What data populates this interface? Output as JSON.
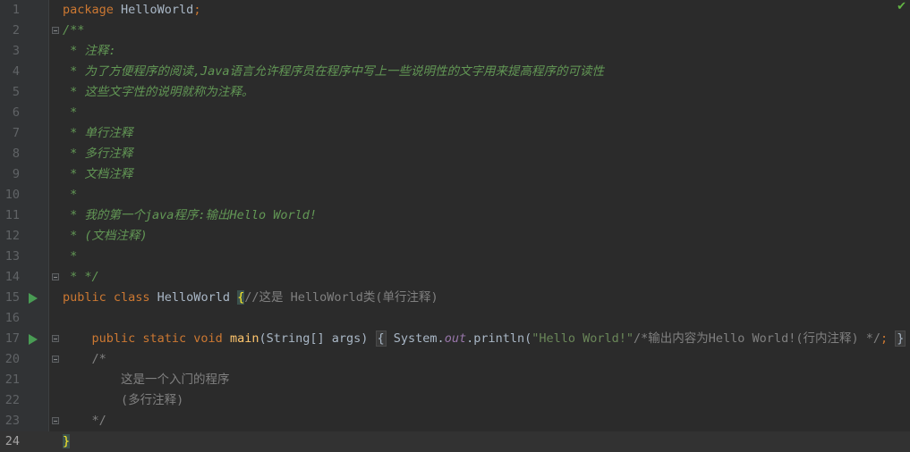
{
  "status": {
    "check_icon": "✔"
  },
  "lines": [
    {
      "num": "1",
      "parts": [
        [
          "kw",
          "package "
        ],
        [
          "txt",
          "HelloWorld"
        ],
        [
          "kw",
          ";"
        ]
      ]
    },
    {
      "num": "2",
      "fold": true,
      "parts": [
        [
          "doc",
          "/**"
        ]
      ]
    },
    {
      "num": "3",
      "parts": [
        [
          "doc",
          " * 注释:"
        ]
      ]
    },
    {
      "num": "4",
      "parts": [
        [
          "doc",
          " * 为了方便程序的阅读,Java语言允许程序员在程序中写上一些说明性的文字用来提高程序的可读性"
        ]
      ]
    },
    {
      "num": "5",
      "parts": [
        [
          "doc",
          " * 这些文字性的说明就称为注释。"
        ]
      ]
    },
    {
      "num": "6",
      "parts": [
        [
          "doc",
          " *"
        ]
      ]
    },
    {
      "num": "7",
      "parts": [
        [
          "doc",
          " * 单行注释"
        ]
      ]
    },
    {
      "num": "8",
      "parts": [
        [
          "doc",
          " * 多行注释"
        ]
      ]
    },
    {
      "num": "9",
      "parts": [
        [
          "doc",
          " * 文档注释"
        ]
      ]
    },
    {
      "num": "10",
      "parts": [
        [
          "doc",
          " *"
        ]
      ]
    },
    {
      "num": "11",
      "parts": [
        [
          "doc",
          " * 我的第一个java程序:输出Hello World!"
        ]
      ]
    },
    {
      "num": "12",
      "parts": [
        [
          "doc",
          " * (文档注释)"
        ]
      ]
    },
    {
      "num": "13",
      "parts": [
        [
          "doc",
          " *"
        ]
      ]
    },
    {
      "num": "14",
      "fold": true,
      "parts": [
        [
          "doc",
          " * */"
        ]
      ]
    },
    {
      "num": "15",
      "run": true,
      "parts": [
        [
          "kw",
          "public class "
        ],
        [
          "txt",
          "HelloWorld "
        ],
        [
          "brace",
          "{"
        ],
        [
          "cm",
          "//这是 HelloWorld类(单行注释)"
        ]
      ]
    },
    {
      "num": "16",
      "parts": []
    },
    {
      "num": "17",
      "run": true,
      "fold": true,
      "parts": [
        [
          "txt",
          "    "
        ],
        [
          "kw",
          "public static void "
        ],
        [
          "fn",
          "main"
        ],
        [
          "txt",
          "(String[] args) "
        ],
        [
          "mark",
          "{"
        ],
        [
          "txt",
          " System."
        ],
        [
          "fld",
          "out"
        ],
        [
          "txt",
          ".println("
        ],
        [
          "str",
          "\"Hello World!\""
        ],
        [
          "cm",
          "/*输出内容为Hello World!(行内注释) */"
        ],
        [
          "kw",
          ";"
        ],
        [
          "txt",
          " "
        ],
        [
          "mark",
          "}"
        ]
      ]
    },
    {
      "num": "20",
      "fold": true,
      "parts": [
        [
          "cm",
          "    /*"
        ]
      ]
    },
    {
      "num": "21",
      "parts": [
        [
          "cm",
          "        这是一个入门的程序"
        ]
      ]
    },
    {
      "num": "22",
      "parts": [
        [
          "cm",
          "        (多行注释)"
        ]
      ]
    },
    {
      "num": "23",
      "fold": true,
      "parts": [
        [
          "cm",
          "    */"
        ]
      ]
    },
    {
      "num": "24",
      "caret": true,
      "parts": [
        [
          "brace",
          "}"
        ]
      ]
    }
  ]
}
